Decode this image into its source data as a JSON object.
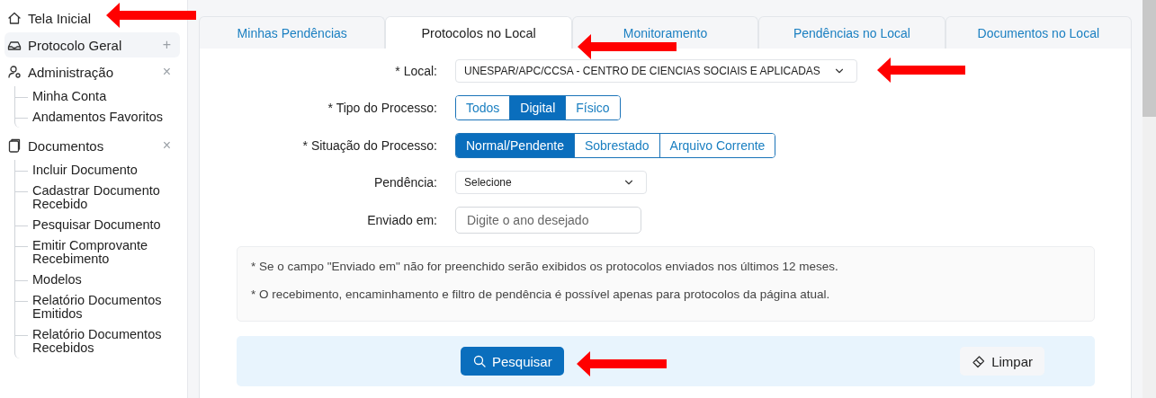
{
  "sidebar": {
    "items": [
      {
        "label": "Tela Inicial",
        "selected": false
      },
      {
        "label": "Protocolo Geral",
        "selected": true,
        "toggle": "+"
      },
      {
        "label": "Administração",
        "selected": false,
        "toggle": "×",
        "children": [
          {
            "label": "Minha Conta"
          },
          {
            "label": "Andamentos Favoritos"
          }
        ]
      },
      {
        "label": "Documentos",
        "selected": false,
        "toggle": "×",
        "children": [
          {
            "label": "Incluir Documento"
          },
          {
            "label": "Cadastrar Documento Recebido"
          },
          {
            "label": "Pesquisar Documento"
          },
          {
            "label": "Emitir Comprovante Recebimento"
          },
          {
            "label": "Modelos"
          },
          {
            "label": "Relatório Documentos Emitidos"
          },
          {
            "label": "Relatório Documentos Recebidos"
          }
        ]
      }
    ]
  },
  "tabs": [
    {
      "label": "Minhas Pendências",
      "selected": false
    },
    {
      "label": "Protocolos no Local",
      "selected": true
    },
    {
      "label": "Monitoramento",
      "selected": false
    },
    {
      "label": "Pendências no Local",
      "selected": false
    },
    {
      "label": "Documentos no Local",
      "selected": false
    }
  ],
  "form": {
    "local": {
      "label": "* Local:",
      "value": "UNESPAR/APC/CCSA - CENTRO DE CIENCIAS SOCIAIS E APLICADAS"
    },
    "tipo": {
      "label": "* Tipo do Processo:",
      "options": [
        {
          "label": "Todos",
          "selected": false
        },
        {
          "label": "Digital",
          "selected": true
        },
        {
          "label": "Físico",
          "selected": false
        }
      ]
    },
    "situacao": {
      "label": "* Situação do Processo:",
      "options": [
        {
          "label": "Normal/Pendente",
          "selected": true
        },
        {
          "label": "Sobrestado",
          "selected": false
        },
        {
          "label": "Arquivo Corrente",
          "selected": false
        }
      ]
    },
    "pendencia": {
      "label": "Pendência:",
      "value": "Selecione"
    },
    "enviado": {
      "label": "Enviado em:",
      "placeholder": "Digite o ano desejado"
    }
  },
  "notes": [
    "* Se o campo \"Enviado em\" não for preenchido serão exibidos os protocolos enviados nos últimos 12 meses.",
    "* O recebimento, encaminhamento e filtro de pendência é possível apenas para protocolos da página atual."
  ],
  "actions": {
    "search": "Pesquisar",
    "clear": "Limpar"
  }
}
